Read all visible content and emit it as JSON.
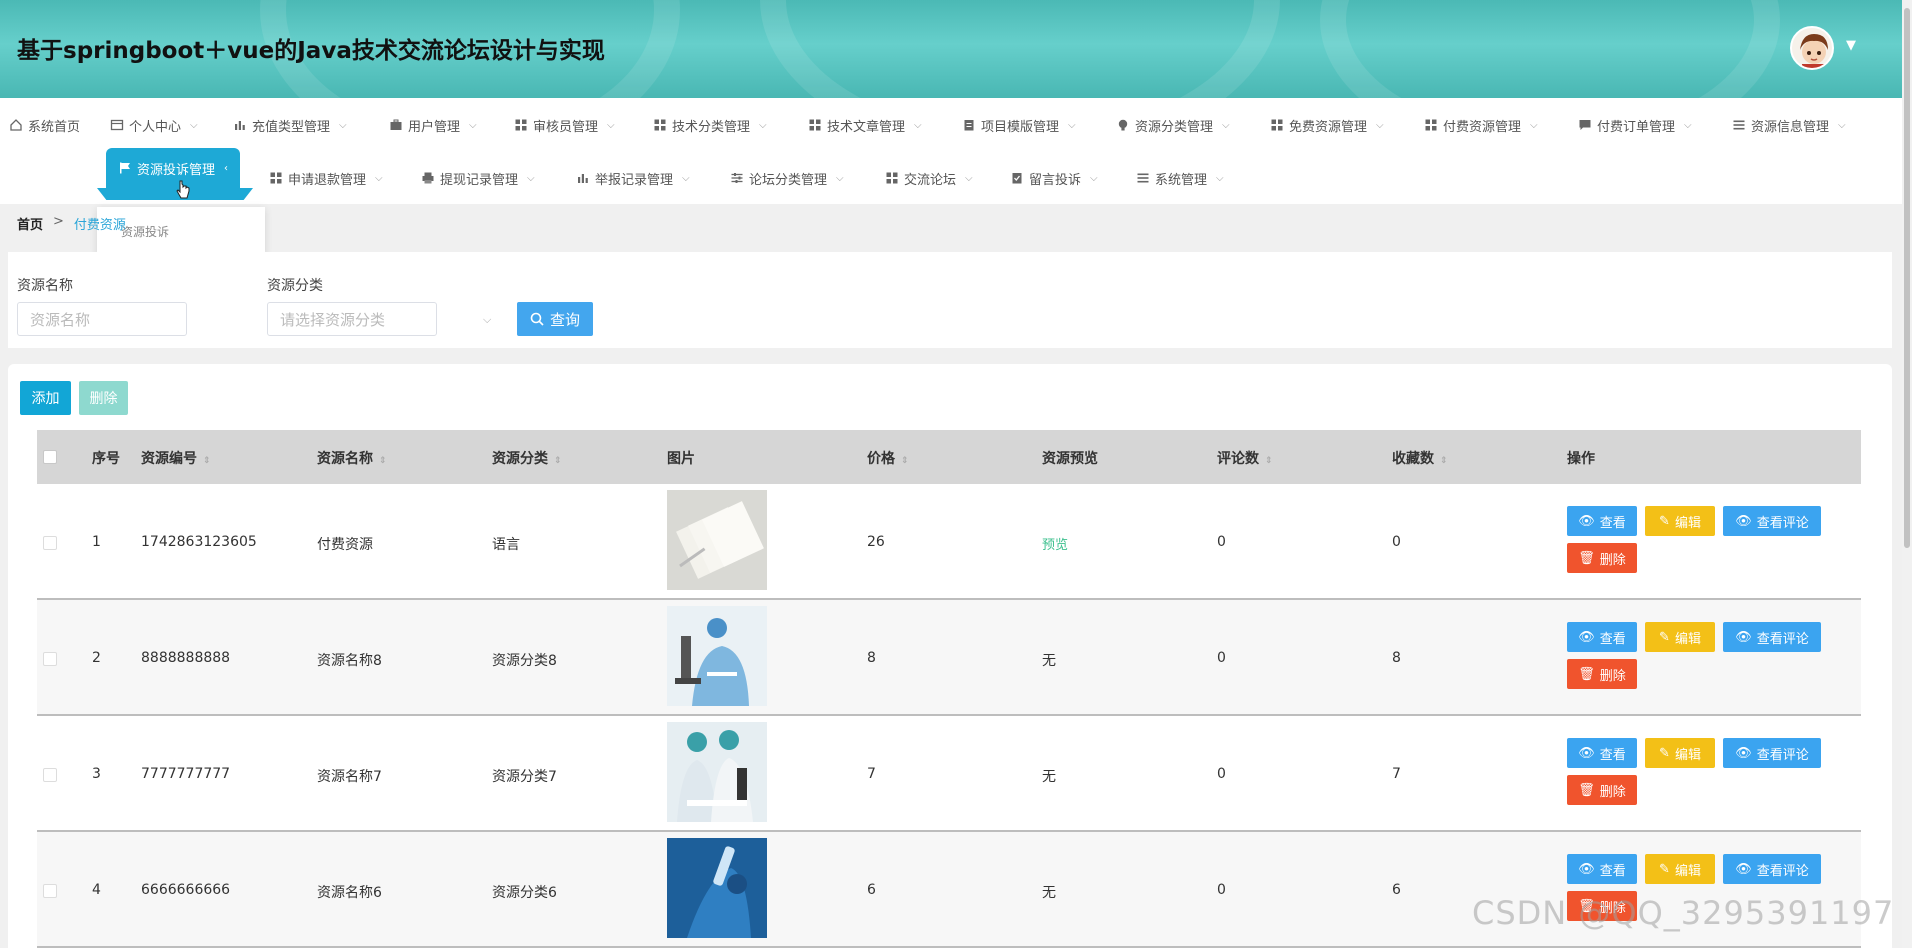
{
  "header": {
    "title": "基于springboot＋vue的Java技术交流论坛设计与实现"
  },
  "nav": {
    "row1": [
      {
        "label": "系统首页",
        "icon": "home-icon",
        "chevron": false
      },
      {
        "label": "个人中心",
        "icon": "user-card-icon",
        "chevron": true
      },
      {
        "label": "充值类型管理",
        "icon": "bar-icon",
        "chevron": true
      },
      {
        "label": "用户管理",
        "icon": "briefcase-icon",
        "chevron": true
      },
      {
        "label": "审核员管理",
        "icon": "grid-icon",
        "chevron": true
      },
      {
        "label": "技术分类管理",
        "icon": "grid-icon",
        "chevron": true
      },
      {
        "label": "技术文章管理",
        "icon": "grid-icon",
        "chevron": true
      },
      {
        "label": "项目模版管理",
        "icon": "clipboard-icon",
        "chevron": true
      },
      {
        "label": "资源分类管理",
        "icon": "bulb-icon",
        "chevron": true
      },
      {
        "label": "免费资源管理",
        "icon": "grid-icon",
        "chevron": true
      },
      {
        "label": "付费资源管理",
        "icon": "grid-icon",
        "chevron": true
      },
      {
        "label": "付费订单管理",
        "icon": "comment-icon",
        "chevron": true
      },
      {
        "label": "资源信息管理",
        "icon": "list-icon",
        "chevron": true
      }
    ],
    "row2": [
      {
        "label": "资源投诉管理",
        "icon": "flag-icon",
        "chevron": true,
        "active": true
      },
      {
        "label": "申请退款管理",
        "icon": "grid-icon",
        "chevron": true
      },
      {
        "label": "提现记录管理",
        "icon": "print-icon",
        "chevron": true
      },
      {
        "label": "举报记录管理",
        "icon": "bar-icon",
        "chevron": true
      },
      {
        "label": "论坛分类管理",
        "icon": "sliders-icon",
        "chevron": true
      },
      {
        "label": "交流论坛",
        "icon": "grid-icon",
        "chevron": true
      },
      {
        "label": "留言投诉",
        "icon": "clipboard-check-icon",
        "chevron": true
      },
      {
        "label": "系统管理",
        "icon": "list-icon",
        "chevron": true
      }
    ],
    "dropdown_item": "资源投诉"
  },
  "breadcrumb": {
    "home": "首页",
    "separator": ">",
    "current": "付费资源"
  },
  "search": {
    "name_label": "资源名称",
    "name_placeholder": "资源名称",
    "category_label": "资源分类",
    "category_placeholder": "请选择资源分类",
    "query_button": "查询"
  },
  "toolbar": {
    "add": "添加",
    "delete": "删除"
  },
  "table": {
    "headers": [
      "序号",
      "资源编号",
      "资源名称",
      "资源分类",
      "图片",
      "价格",
      "资源预览",
      "评论数",
      "收藏数",
      "操作"
    ],
    "rows": [
      {
        "index": "1",
        "code": "1742863123605",
        "name": "付费资源",
        "category": "语言",
        "price": "26",
        "preview": "预览",
        "comments": "0",
        "favorites": "0",
        "image": "notebooks"
      },
      {
        "index": "2",
        "code": "8888888888",
        "name": "资源名称8",
        "category": "资源分类8",
        "price": "8",
        "preview": "无",
        "comments": "0",
        "favorites": "8",
        "image": "lab-microscope"
      },
      {
        "index": "3",
        "code": "7777777777",
        "name": "资源名称7",
        "category": "资源分类7",
        "price": "7",
        "preview": "无",
        "comments": "0",
        "favorites": "7",
        "image": "lab-pair"
      },
      {
        "index": "4",
        "code": "6666666666",
        "name": "资源名称6",
        "category": "资源分类6",
        "price": "6",
        "preview": "无",
        "comments": "0",
        "favorites": "6",
        "image": "lab-vial"
      }
    ],
    "actions": {
      "view": "查看",
      "edit": "编辑",
      "comments": "查看评论",
      "delete": "删除"
    }
  },
  "watermark": "CSDN @QQ_3295391197",
  "colors": {
    "accent": "#1ea9d6",
    "query": "#43a6ee",
    "view": "#3ba4f0",
    "edit": "#f3c017",
    "danger": "#f0542d",
    "preview": "#3cc08e"
  }
}
